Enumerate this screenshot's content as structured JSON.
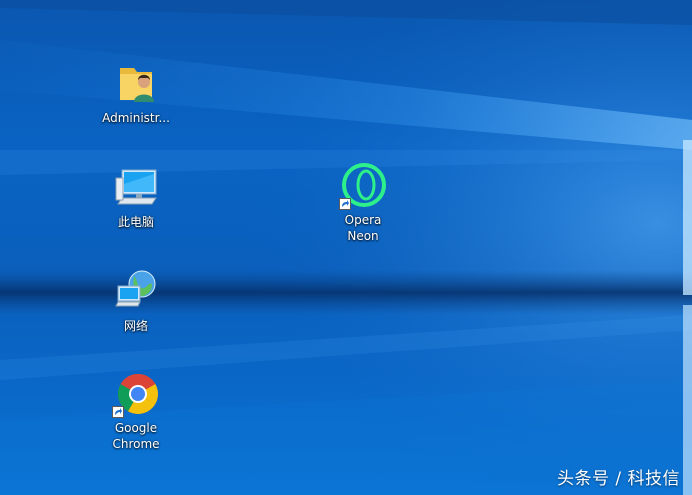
{
  "desktop": {
    "icons": [
      {
        "label": "Administr...",
        "icon": "user-folder-icon"
      },
      {
        "label": "此电脑",
        "icon": "computer-icon"
      },
      {
        "label": "网络",
        "icon": "network-icon"
      },
      {
        "label": "Google\nChrome",
        "icon": "chrome-icon",
        "shortcut": true
      },
      {
        "label": "Opera\nNeon",
        "icon": "opera-neon-icon",
        "shortcut": true
      }
    ]
  },
  "watermark": {
    "text": "头条号 / 科技信"
  },
  "colors": {
    "wallpaper_blue": "#0a63c3",
    "opera_neon_green": "#2df08a",
    "chrome_red": "#db4437",
    "chrome_yellow": "#f4c20d",
    "chrome_green": "#0f9d58",
    "chrome_blue": "#4285f4"
  }
}
